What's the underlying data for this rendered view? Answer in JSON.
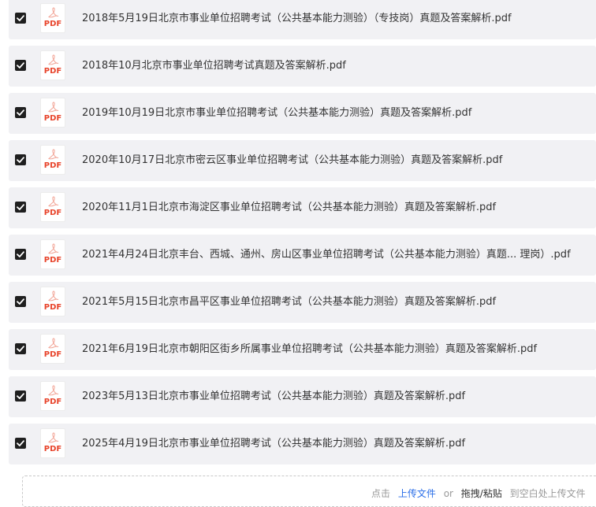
{
  "colors": {
    "row_background": "#f1f1f4",
    "checkbox_fill": "#1f1f1f",
    "pdf_red": "#e8442b",
    "link_blue": "#2a6ee8",
    "text": "#333333",
    "muted": "#999999"
  },
  "icons": {
    "checkbox": "checkbox-checked-icon",
    "file": "pdf-file-icon"
  },
  "files": [
    {
      "checked": true,
      "icon_label": "PDF",
      "name": "2018年5月19日北京市事业单位招聘考试（公共基本能力测验）（专技岗）真题及答案解析.pdf"
    },
    {
      "checked": true,
      "icon_label": "PDF",
      "name": "2018年10月北京市事业单位招聘考试真题及答案解析.pdf"
    },
    {
      "checked": true,
      "icon_label": "PDF",
      "name": "2019年10月19日北京市事业单位招聘考试（公共基本能力测验）真题及答案解析.pdf"
    },
    {
      "checked": true,
      "icon_label": "PDF",
      "name": "2020年10月17日北京市密云区事业单位招聘考试（公共基本能力测验）真题及答案解析.pdf"
    },
    {
      "checked": true,
      "icon_label": "PDF",
      "name": "2020年11月1日北京市海淀区事业单位招聘考试（公共基本能力测验）真题及答案解析.pdf"
    },
    {
      "checked": true,
      "icon_label": "PDF",
      "name": "2021年4月24日北京丰台、西城、通州、房山区事业单位招聘考试（公共基本能力测验）真题... 理岗）.pdf"
    },
    {
      "checked": true,
      "icon_label": "PDF",
      "name": "2021年5月15日北京市昌平区事业单位招聘考试（公共基本能力测验）真题及答案解析.pdf"
    },
    {
      "checked": true,
      "icon_label": "PDF",
      "name": "2021年6月19日北京市朝阳区街乡所属事业单位招聘考试（公共基本能力测验）真题及答案解析.pdf"
    },
    {
      "checked": true,
      "icon_label": "PDF",
      "name": "2023年5月13日北京市事业单位招聘考试（公共基本能力测验）真题及答案解析.pdf"
    },
    {
      "checked": true,
      "icon_label": "PDF",
      "name": "2025年4月19日北京市事业单位招聘考试（公共基本能力测验）真题及答案解析.pdf"
    }
  ],
  "upload": {
    "click_label": "点击",
    "upload_link": "上传文件",
    "or_label": "or",
    "drag_paste": "拖拽/粘贴",
    "blank_hint": "到空白处上传文件"
  }
}
